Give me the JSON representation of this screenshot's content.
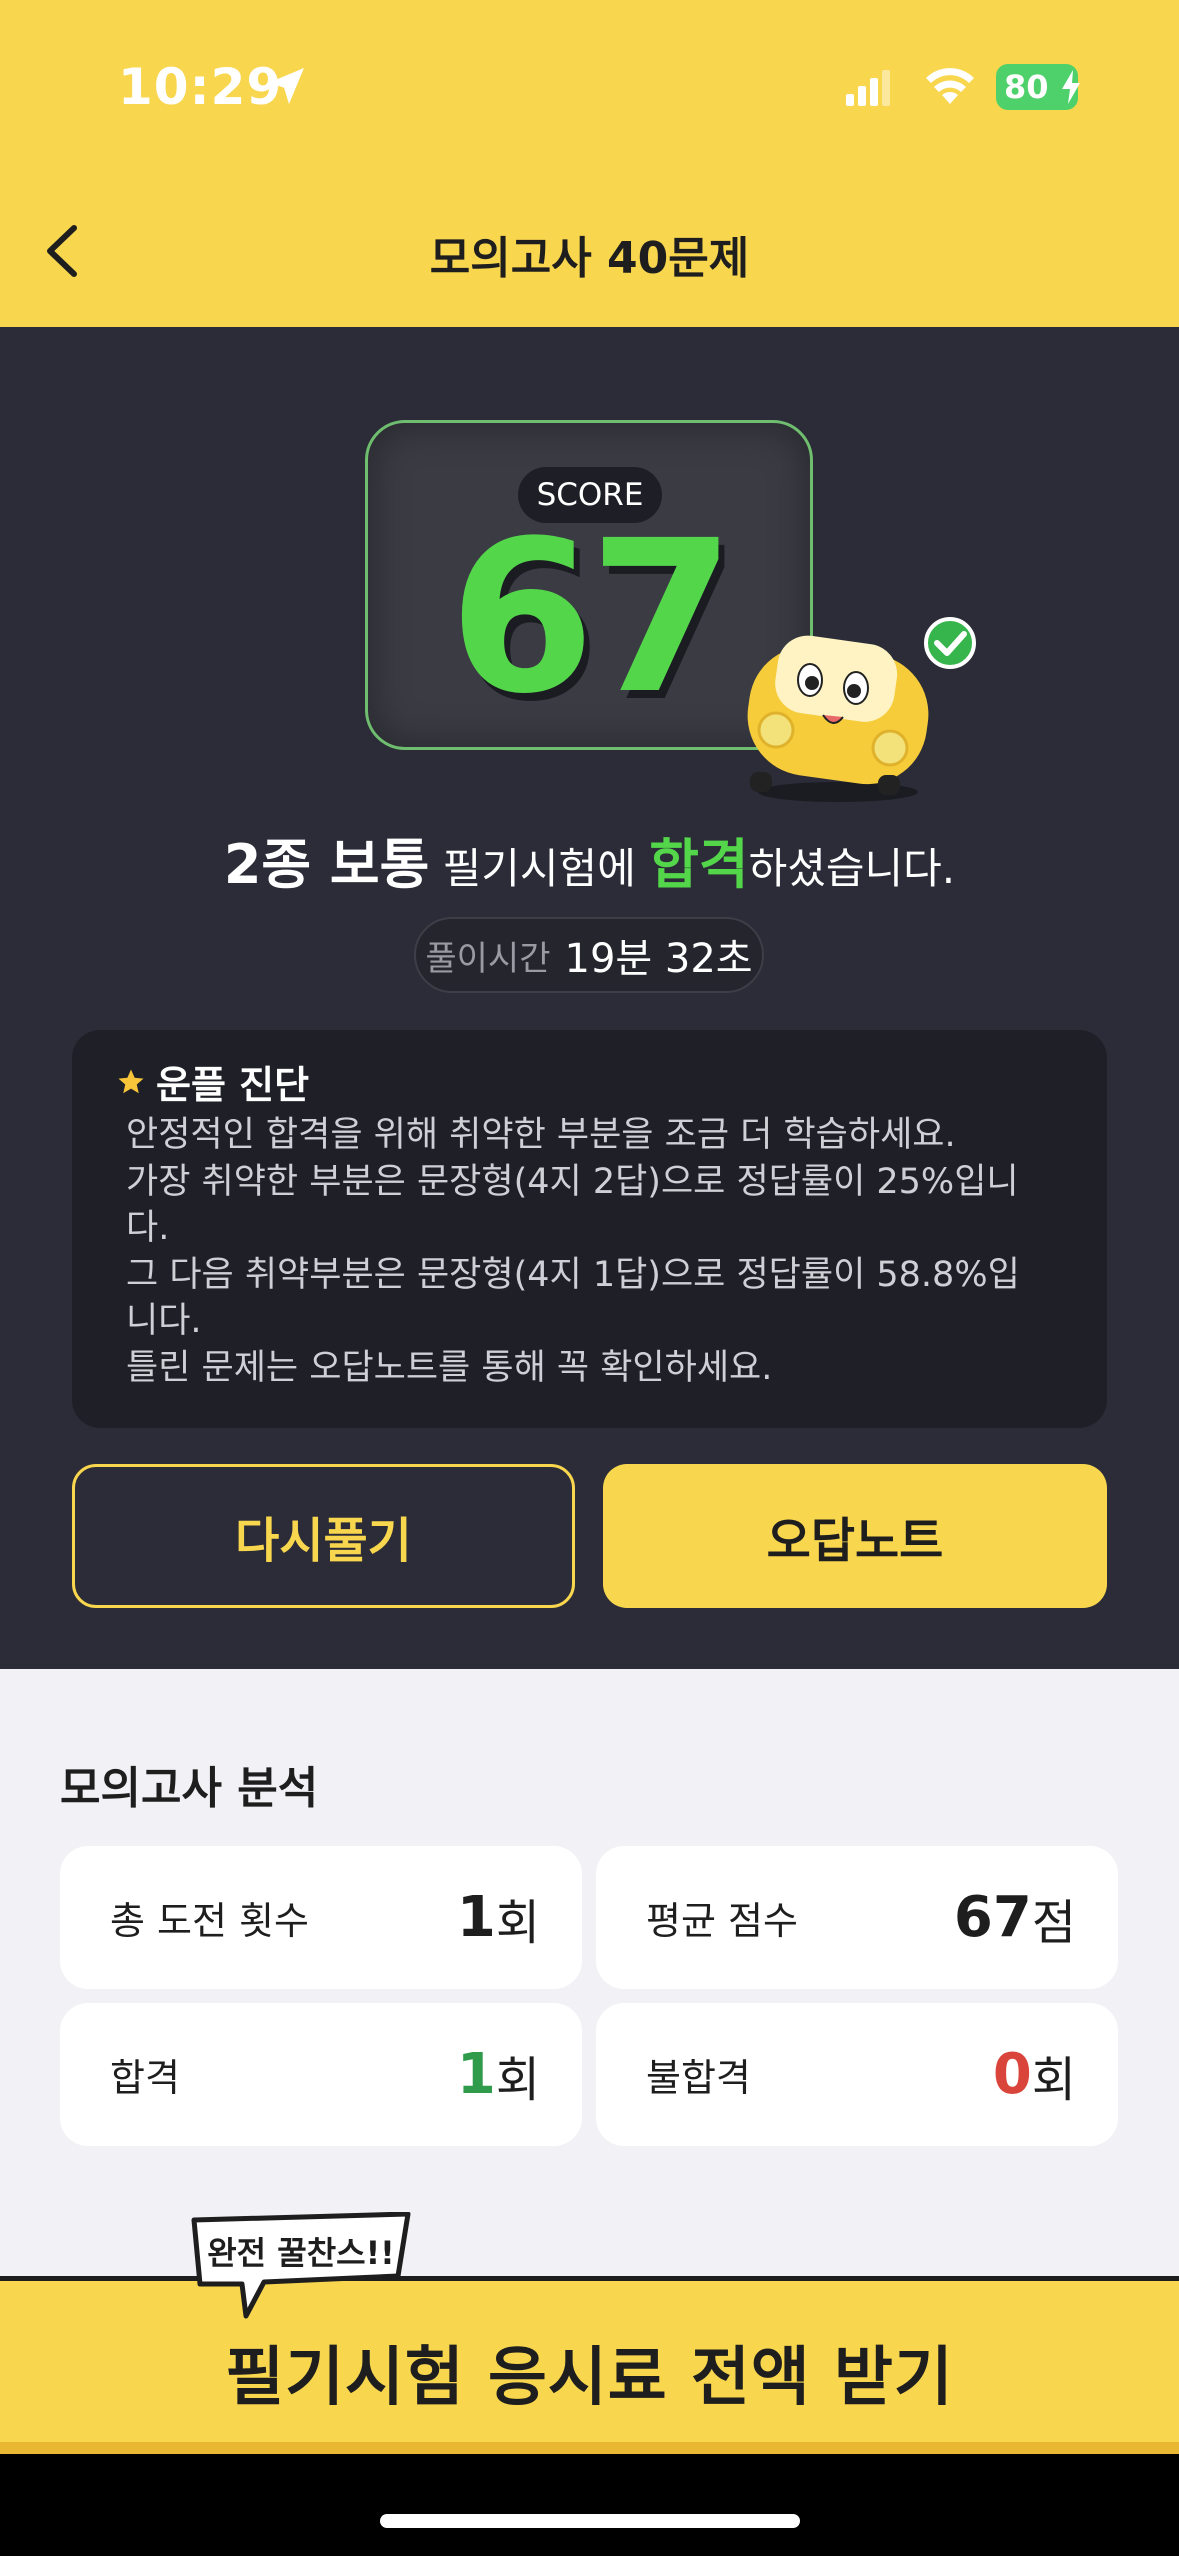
{
  "status_bar": {
    "time": "10:29",
    "battery": "80"
  },
  "header": {
    "title": "모의고사 40문제"
  },
  "score": {
    "label": "SCORE",
    "value": "67"
  },
  "result": {
    "license": "2종 보통",
    "mid": " 필기시험에 ",
    "pass_word": "합격",
    "tail": "하셨습니다."
  },
  "solve_time": {
    "label": "풀이시간",
    "value": "19분 32초"
  },
  "diagnosis": {
    "title": "운플 진단",
    "lines": [
      "안정적인 합격을 위해 취약한 부분을 조금 더 학습하세요.",
      "가장 취약한 부분은 문장형(4지 2답)으로 정답률이 25%입니다.",
      "그 다음 취약부분은 문장형(4지 1답)으로 정답률이 58.8%입니다.",
      "틀린 문제는 오답노트를 통해 꼭 확인하세요."
    ]
  },
  "buttons": {
    "retry": "다시풀기",
    "wrong_note": "오답노트"
  },
  "analysis": {
    "title": "모의고사 분석",
    "cards": [
      {
        "label": "총 도전 횟수",
        "value": "1",
        "unit": "회"
      },
      {
        "label": "평균 점수",
        "value": "67",
        "unit": "점"
      },
      {
        "label": "합격",
        "value": "1",
        "unit": "회"
      },
      {
        "label": "불합격",
        "value": "0",
        "unit": "회"
      }
    ]
  },
  "promo": {
    "bubble": "완전 꿀찬스!!",
    "text": "필기시험 응시료 전액 받기"
  },
  "colors": {
    "brand_yellow": "#f8d64e",
    "dark_bg": "#2b2c37",
    "pass_green": "#54d64b",
    "fail_red": "#d9443b"
  }
}
